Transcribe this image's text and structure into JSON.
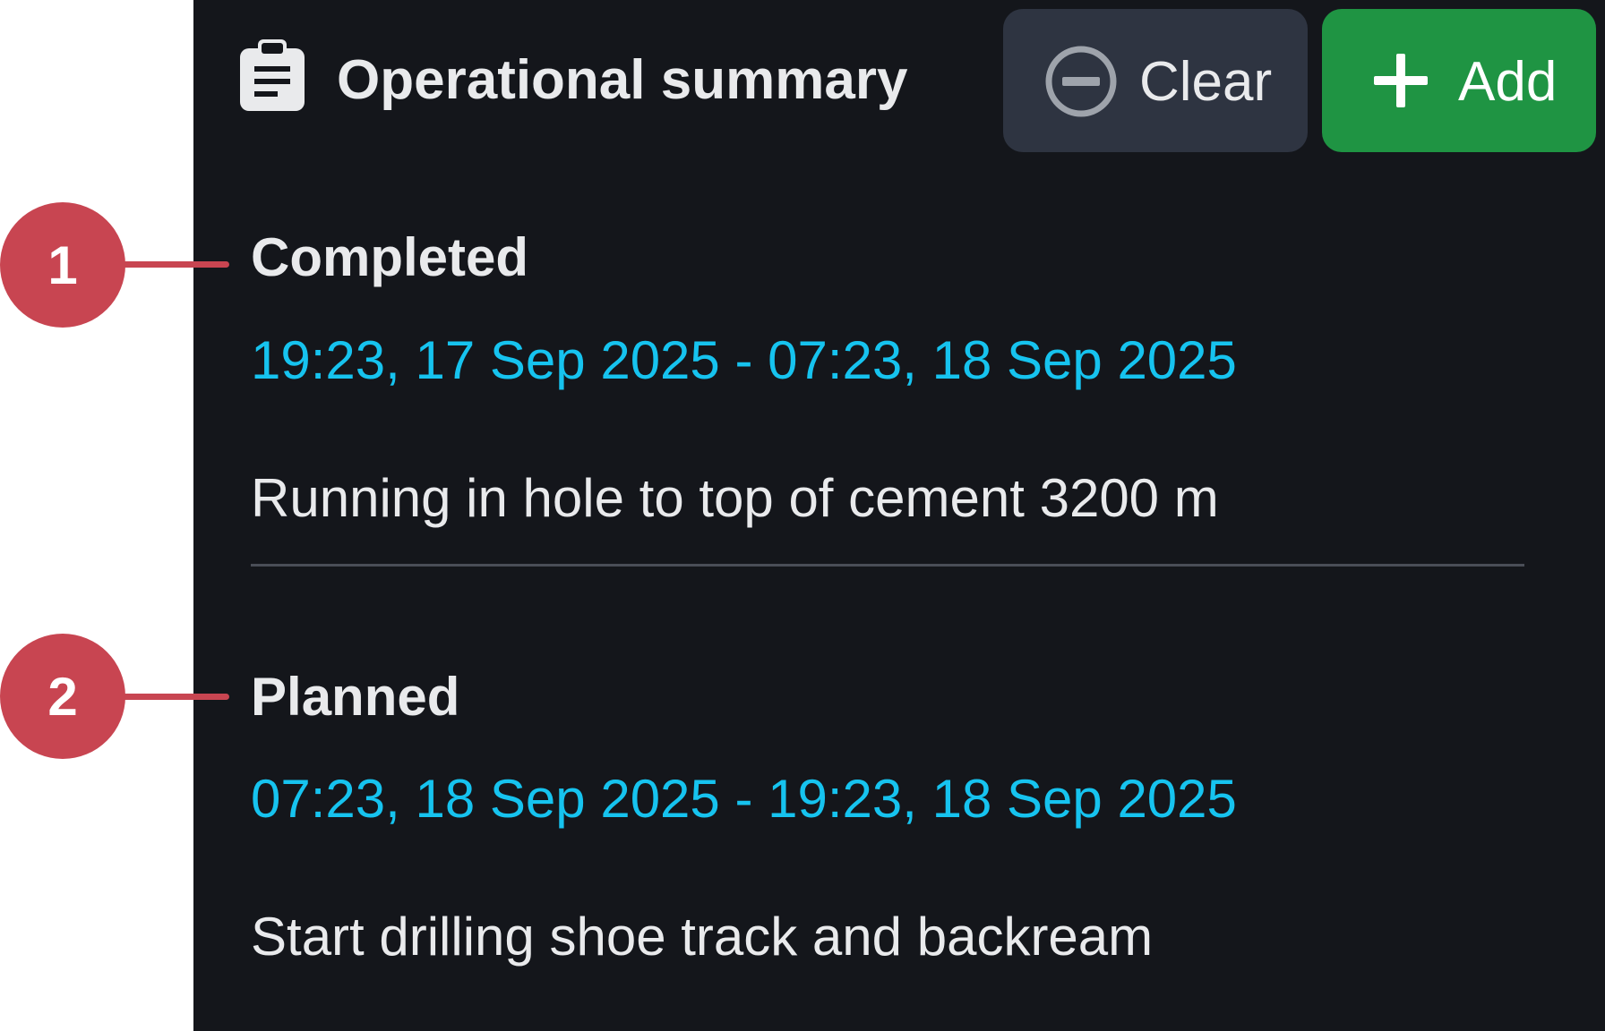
{
  "header": {
    "icon": "clipboard-list-icon",
    "title": "Operational summary",
    "clear_button": {
      "label": "Clear",
      "icon": "minus-circle-icon"
    },
    "add_button": {
      "label": "Add",
      "icon": "plus-icon"
    }
  },
  "callouts": [
    "1",
    "2"
  ],
  "sections": [
    {
      "title": "Completed",
      "time_range": "19:23, 17 Sep 2025 - 07:23, 18 Sep 2025",
      "description": "Running in hole to top of cement 3200 m"
    },
    {
      "title": "Planned",
      "time_range": "07:23, 18 Sep 2025 - 19:23, 18 Sep 2025",
      "description": "Start drilling shoe track and backream"
    }
  ],
  "colors": {
    "panel_background": "#14161b",
    "time_text": "#16c3ef",
    "add_button": "#1f9443",
    "clear_button": "#2e3441",
    "callout": "#c84551"
  }
}
